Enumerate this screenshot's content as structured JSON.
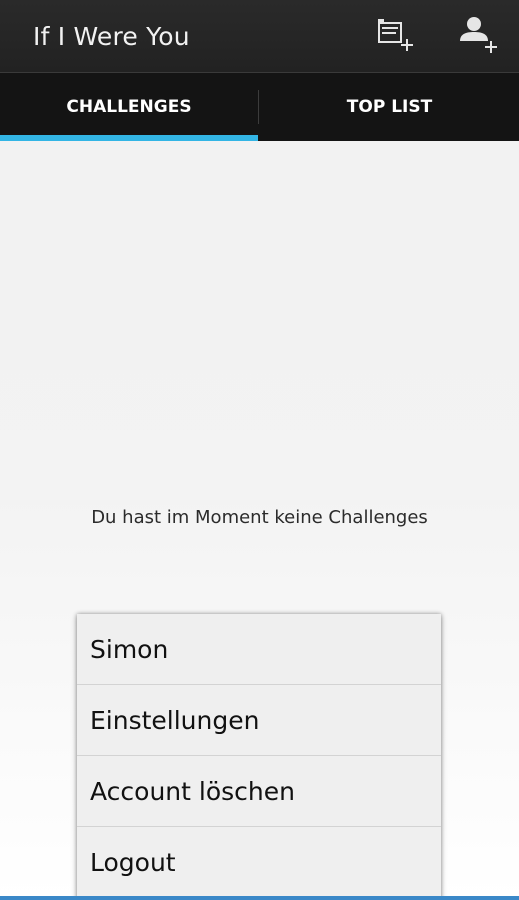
{
  "action_bar": {
    "title": "If I Were You",
    "buttons": [
      {
        "icon": "add-challenge-icon"
      },
      {
        "icon": "add-user-icon"
      }
    ]
  },
  "tabs": [
    {
      "label": "CHALLENGES",
      "selected": true
    },
    {
      "label": "TOP LIST",
      "selected": false
    }
  ],
  "content": {
    "empty_message": "Du hast im Moment keine Challenges"
  },
  "popup_menu": {
    "items": [
      {
        "label": "Simon"
      },
      {
        "label": "Einstellungen"
      },
      {
        "label": "Account löschen"
      },
      {
        "label": "Logout"
      }
    ]
  },
  "colors": {
    "accent": "#33b5e5",
    "action_bar": "#262626",
    "tab_bar": "#141414",
    "menu_background": "#efefef"
  }
}
